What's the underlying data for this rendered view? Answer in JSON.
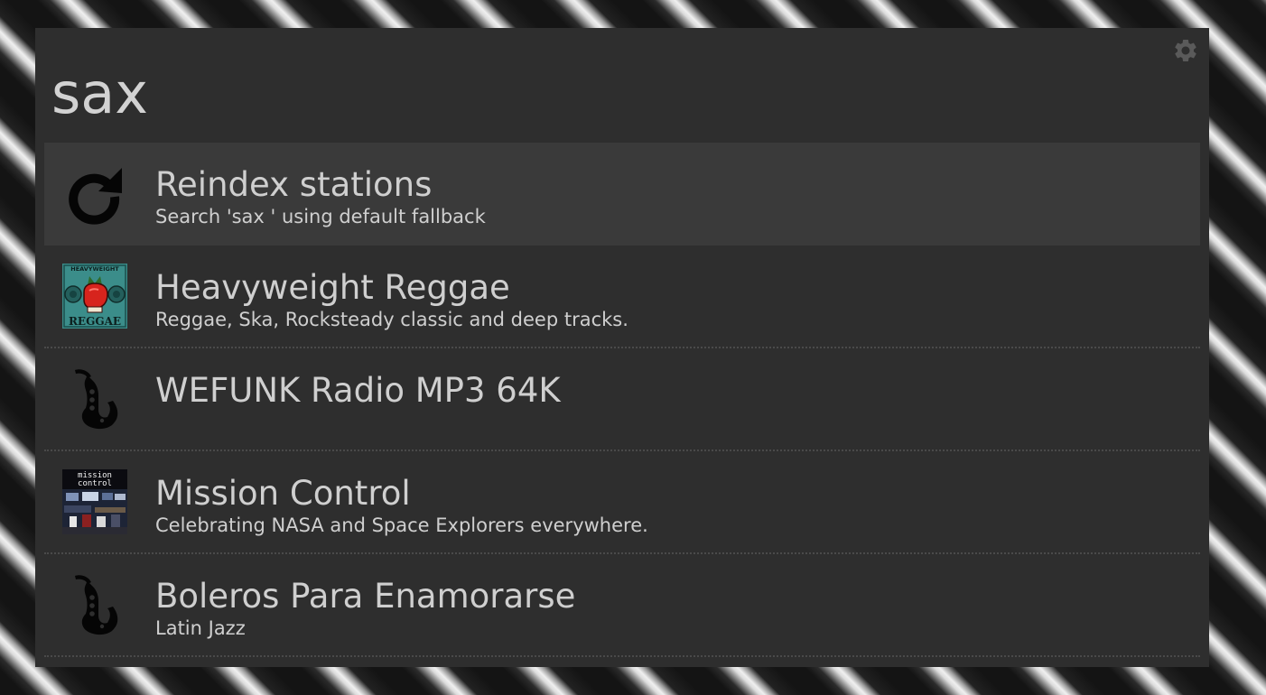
{
  "search": {
    "query": "sax"
  },
  "results": [
    {
      "title": "Reindex stations",
      "description": "Search 'sax ' using default fallback",
      "icon": "refresh-icon"
    },
    {
      "title": "Heavyweight Reggae",
      "description": "Reggae, Ska, Rocksteady classic and deep tracks.",
      "icon": "heavyweight-reggae-logo",
      "icon_text_top": "HEAVYWEIGHT",
      "icon_text_bottom": "REGGAE"
    },
    {
      "title": "WEFUNK Radio MP3 64K",
      "description": "",
      "icon": "saxophone-icon"
    },
    {
      "title": "Mission Control",
      "description": "Celebrating NASA and Space Explorers everywhere.",
      "icon": "mission-control-logo",
      "icon_text_top": "mission",
      "icon_text_bottom": "control"
    },
    {
      "title": "Boleros Para Enamorarse",
      "description": "Latin Jazz",
      "icon": "saxophone-icon"
    }
  ],
  "colors": {
    "window_bg": "#2e2e2e",
    "selected_bg": "#3a3a3a",
    "text": "#cfcfcf",
    "separator": "#4a4a4a"
  },
  "icons": {
    "settings": "gear-icon"
  }
}
